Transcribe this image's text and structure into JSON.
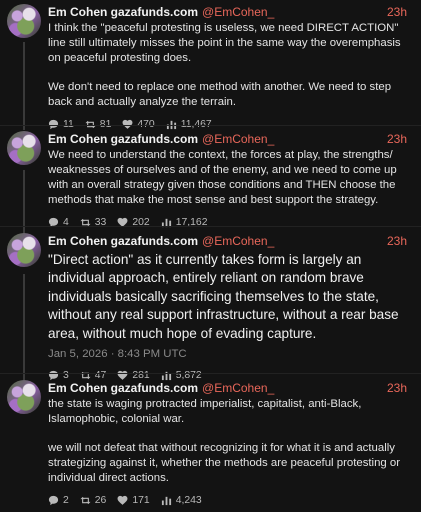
{
  "posts": [
    {
      "name": "Em Cohen gazafunds.com",
      "handle": "@EmCohen_",
      "time": "23h",
      "paragraphs": [
        "I think the \"peaceful protesting is useless, we need DIRECT ACTION\" line still ultimately misses the point in the same way the overemphasis on peaceful protesting does.",
        "We don't need to replace one method with another. We need to step back and actually analyze the terrain."
      ],
      "replies": "11",
      "reposts": "81",
      "likes": "470",
      "views": "11,467"
    },
    {
      "name": "Em Cohen gazafunds.com",
      "handle": "@EmCohen_",
      "time": "23h",
      "paragraphs": [
        "We need to understand the context, the forces at play, the strengths/ weaknesses of ourselves and of the enemy, and we need to come up with an overall strategy given those conditions and THEN choose the methods that make the most sense and best support the strategy."
      ],
      "replies": "4",
      "reposts": "33",
      "likes": "202",
      "views": "17,162"
    },
    {
      "name": "Em Cohen gazafunds.com",
      "handle": "@EmCohen_",
      "time": "23h",
      "paragraphs": [
        "\"Direct action\" as it currently takes form is largely an individual approach, entirely reliant on random brave individuals basically sacrificing themselves to the state, without any real support infrastructure, without a rear base area, without much hope of evading capture."
      ],
      "timestamp": "Jan 5, 2026 · 8:43 PM UTC",
      "replies": "3",
      "reposts": "47",
      "likes": "281",
      "views": "5,872"
    },
    {
      "name": "Em Cohen gazafunds.com",
      "handle": "@EmCohen_",
      "time": "23h",
      "paragraphs": [
        "the state is waging protracted imperialist, capitalist, anti-Black, Islamophobic, colonial war.",
        "we will not defeat that without recognizing it for what it is and actually strategizing against it, whether the methods are peaceful protesting or individual direct actions."
      ],
      "replies": "2",
      "reposts": "26",
      "likes": "171",
      "views": "4,243"
    }
  ]
}
